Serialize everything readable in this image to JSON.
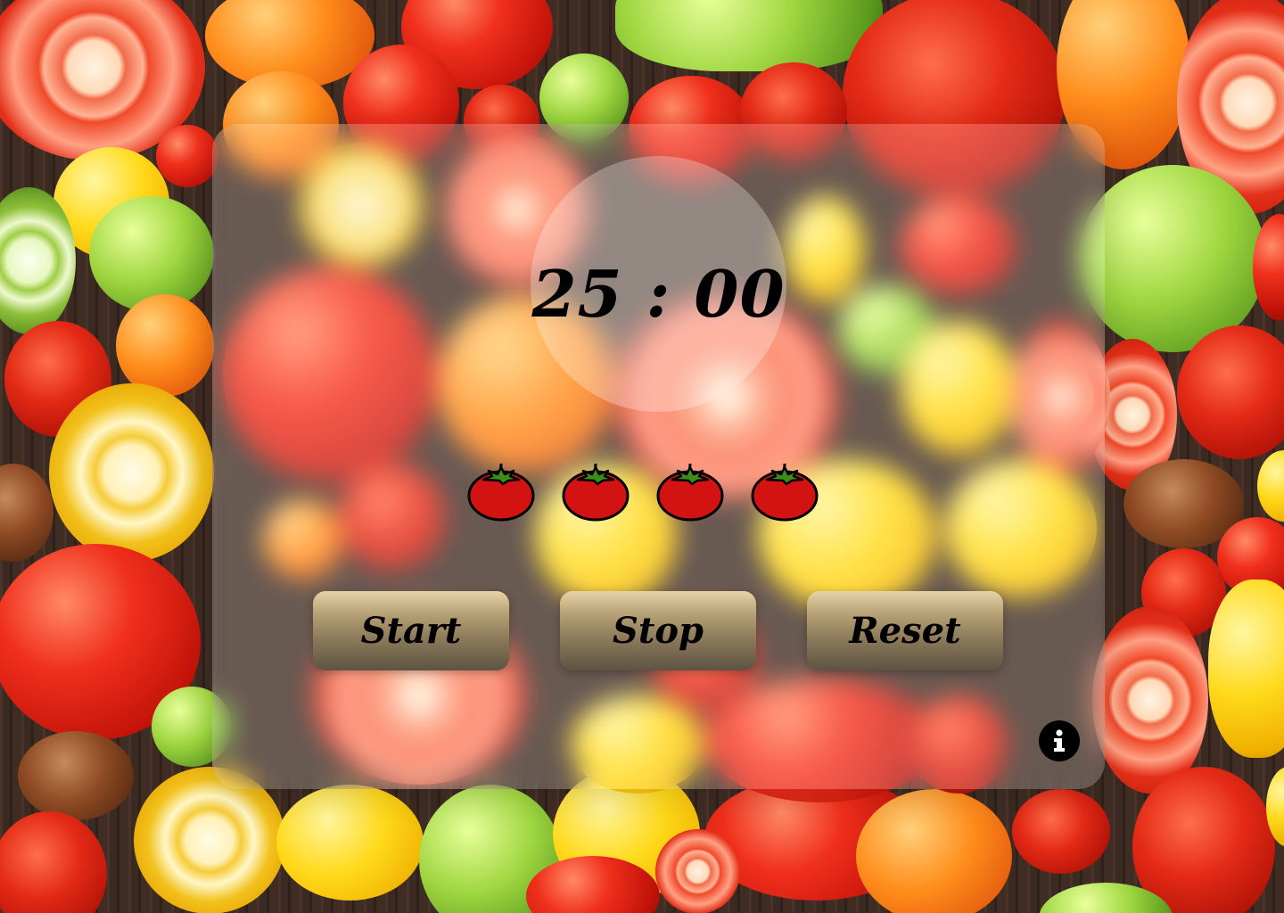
{
  "timer": {
    "display": "25 : 00"
  },
  "pomodoro_tomatoes": {
    "count": 4,
    "icon": "tomato-icon"
  },
  "controls": {
    "start_label": "Start",
    "stop_label": "Stop",
    "reset_label": "Reset"
  },
  "info_button": {
    "icon": "info-icon"
  },
  "colors": {
    "tomato_red": "#d31212",
    "tomato_leaf": "#3d8c1a",
    "button_top": "#e6d3a6",
    "button_bottom": "#5d5344",
    "text": "#000000"
  }
}
